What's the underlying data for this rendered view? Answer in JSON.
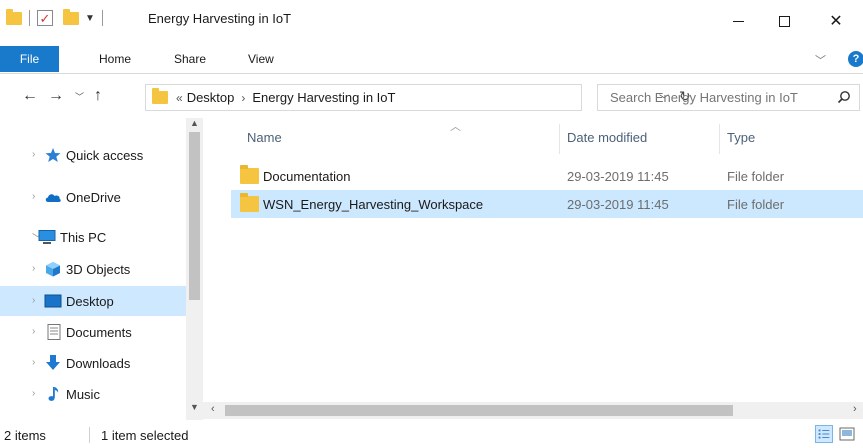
{
  "window": {
    "title": "Energy Harvesting in IoT",
    "minimize_glyph": "",
    "close_glyph": "✕"
  },
  "ribbon": {
    "tabs": [
      {
        "label": "File"
      },
      {
        "label": "Home"
      },
      {
        "label": "Share"
      },
      {
        "label": "View"
      }
    ],
    "accent_color": "#1979ca"
  },
  "address_bar": {
    "overflow": "«",
    "breadcrumbs": [
      "Desktop",
      "Energy Harvesting in IoT"
    ],
    "separator": "›"
  },
  "search": {
    "placeholder": "Search Energy Harvesting in IoT"
  },
  "nav_pane": {
    "items": [
      {
        "label": "Quick access",
        "icon": "star-icon"
      },
      {
        "label": "OneDrive",
        "icon": "cloud-icon"
      },
      {
        "label": "This PC",
        "icon": "computer-icon"
      },
      {
        "label": "3D Objects",
        "icon": "cube-icon"
      },
      {
        "label": "Desktop",
        "icon": "desktop-icon",
        "selected": true
      },
      {
        "label": "Documents",
        "icon": "document-icon"
      },
      {
        "label": "Downloads",
        "icon": "download-icon"
      },
      {
        "label": "Music",
        "icon": "music-icon"
      }
    ]
  },
  "file_list": {
    "columns": [
      "Name",
      "Date modified",
      "Type"
    ],
    "rows": [
      {
        "name": "Documentation",
        "date": "29-03-2019 11:45",
        "type": "File folder",
        "selected": false
      },
      {
        "name": "WSN_Energy_Harvesting_Workspace",
        "date": "29-03-2019 11:45",
        "type": "File folder",
        "selected": true
      }
    ]
  },
  "status_bar": {
    "item_count": "2 items",
    "selection": "1 item selected"
  },
  "colors": {
    "selection": "#cce8ff",
    "folder": "#f5c542"
  }
}
